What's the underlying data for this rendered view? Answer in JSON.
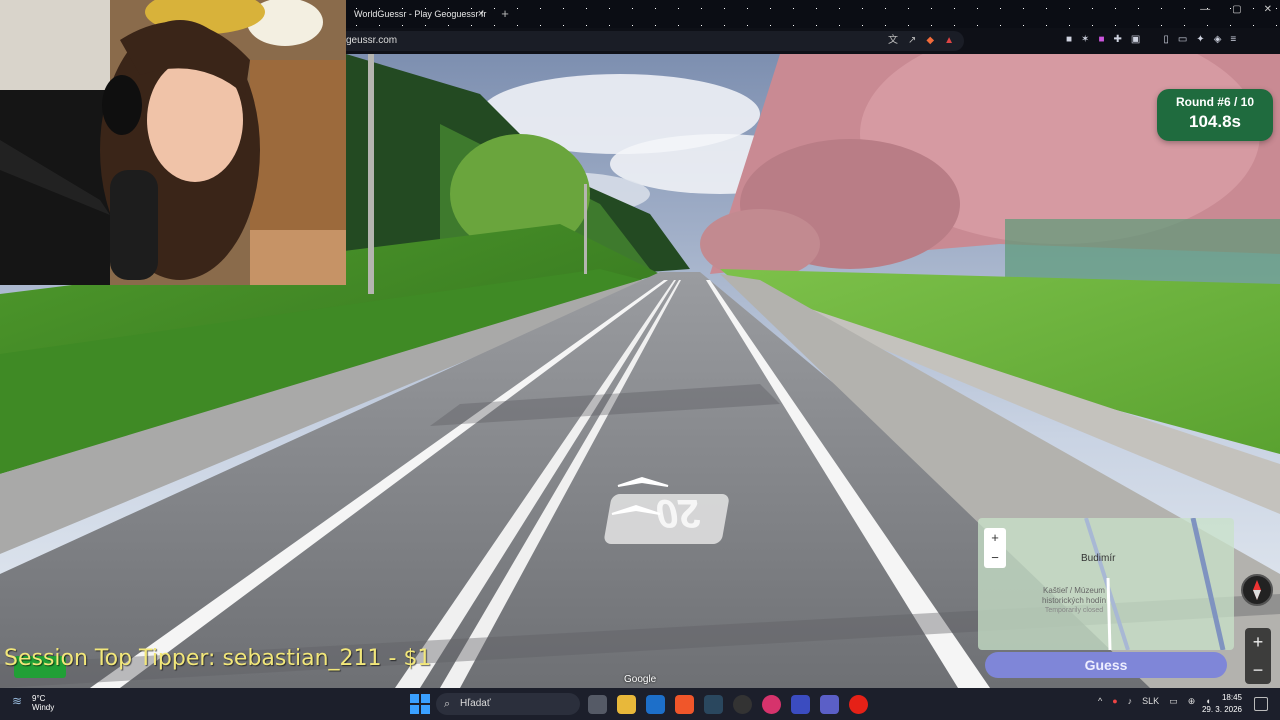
{
  "browser": {
    "tab_title": "WorldGuessr - Play Geoguessr fr",
    "tab_close": "×",
    "new_tab": "+",
    "url": "geussr.com",
    "window_controls": [
      "—",
      "▢",
      "✕"
    ]
  },
  "game": {
    "round_label": "Round #6 / 10",
    "timer": "104.8s",
    "guess_button": "Guess",
    "map_zoom_in": "+",
    "map_zoom_out": "−",
    "map_town": "Budimír",
    "map_poi": "Kaštieľ / Múzeum historických hodín",
    "map_poi_status": "Temporarily closed",
    "sv_zoom_in": "+",
    "sv_zoom_out": "−",
    "road_marking": "20",
    "google_attribution": "Google"
  },
  "overlay": {
    "tipper_text": "Session Top Tipper: sebastian_211 - $1"
  },
  "taskbar": {
    "weather_temp": "9°C",
    "weather_desc": "Windy",
    "search_placeholder": "Hľadať",
    "language": "SLK",
    "time": "18:45",
    "date": "29. 3. 2026"
  },
  "colors": {
    "round_panel": "#1f6b3e",
    "guess_button": "#7f86d8",
    "tipper_text": "#f2e77a"
  }
}
